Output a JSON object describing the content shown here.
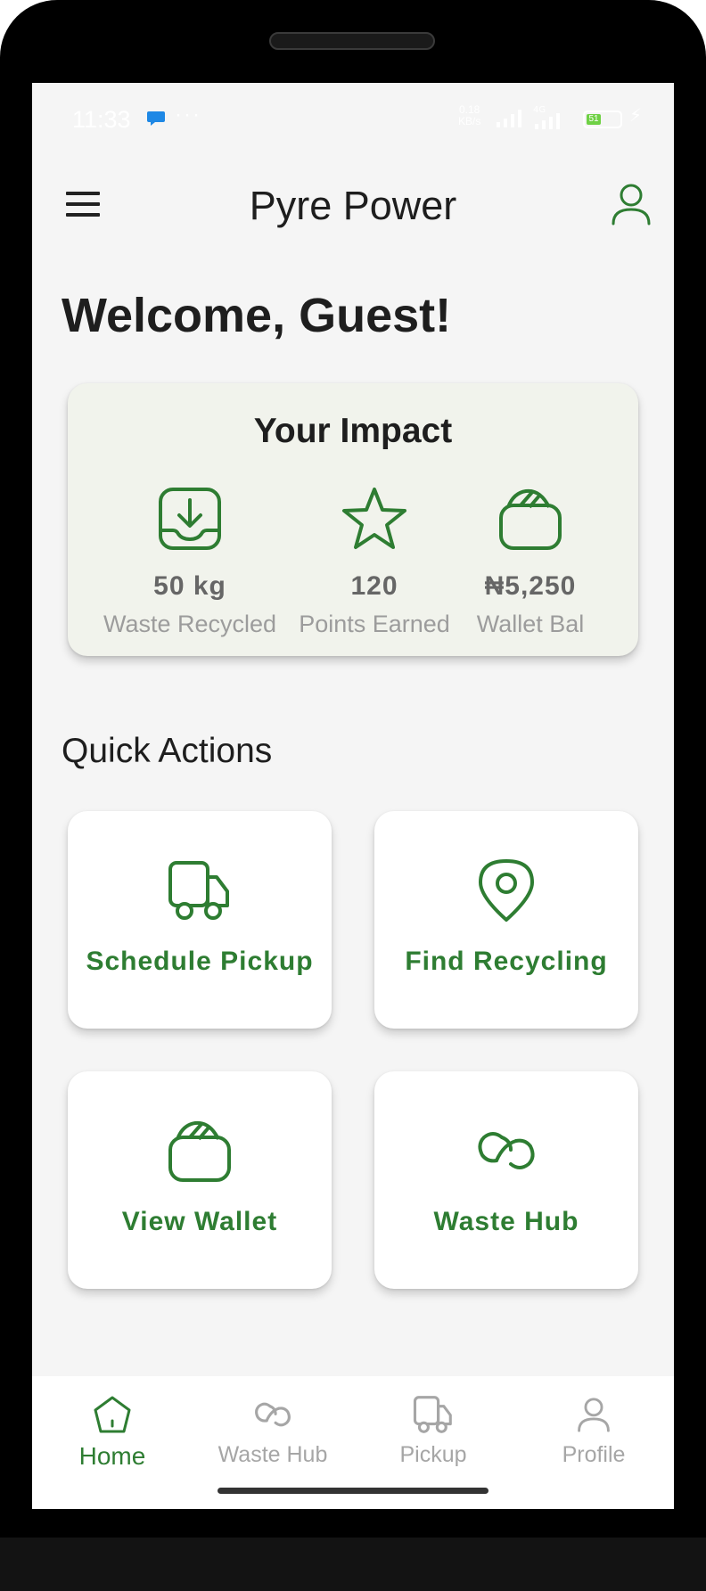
{
  "status_bar": {
    "time": "11:33",
    "dots": "···",
    "speed_value": "0.18",
    "speed_unit": "KB/s",
    "battery": "51"
  },
  "app_bar": {
    "title": "Pyre Power",
    "menu_icon": "menu-icon",
    "profile_icon": "user-icon"
  },
  "welcome": "Welcome, Guest!",
  "impact": {
    "title": "Your Impact",
    "stats": [
      {
        "icon": "download-tray-icon",
        "value": "50 kg",
        "label": "Waste Recycled"
      },
      {
        "icon": "star-icon",
        "value": "120",
        "label": "Points Earned"
      },
      {
        "icon": "wallet-icon",
        "value": "₦5,250",
        "label": "Wallet Bal"
      }
    ]
  },
  "quick_actions": {
    "title": "Quick Actions",
    "items": [
      {
        "icon": "truck-icon",
        "label": "Schedule Pickup"
      },
      {
        "icon": "location-pin-icon",
        "label": "Find Recycling"
      },
      {
        "icon": "wallet-icon",
        "label": "View Wallet"
      },
      {
        "icon": "link-icon",
        "label": "Waste Hub"
      }
    ]
  },
  "bottom_nav": {
    "items": [
      {
        "icon": "home-icon",
        "label": "Home",
        "active": true
      },
      {
        "icon": "link-icon",
        "label": "Waste Hub",
        "active": false
      },
      {
        "icon": "truck-icon",
        "label": "Pickup",
        "active": false
      },
      {
        "icon": "user-icon",
        "label": "Profile",
        "active": false
      }
    ]
  },
  "colors": {
    "accent": "#2e7d32",
    "background": "#f5f5f5",
    "impact_card": "#f1f3ec",
    "inactive": "#a6a6a6"
  }
}
